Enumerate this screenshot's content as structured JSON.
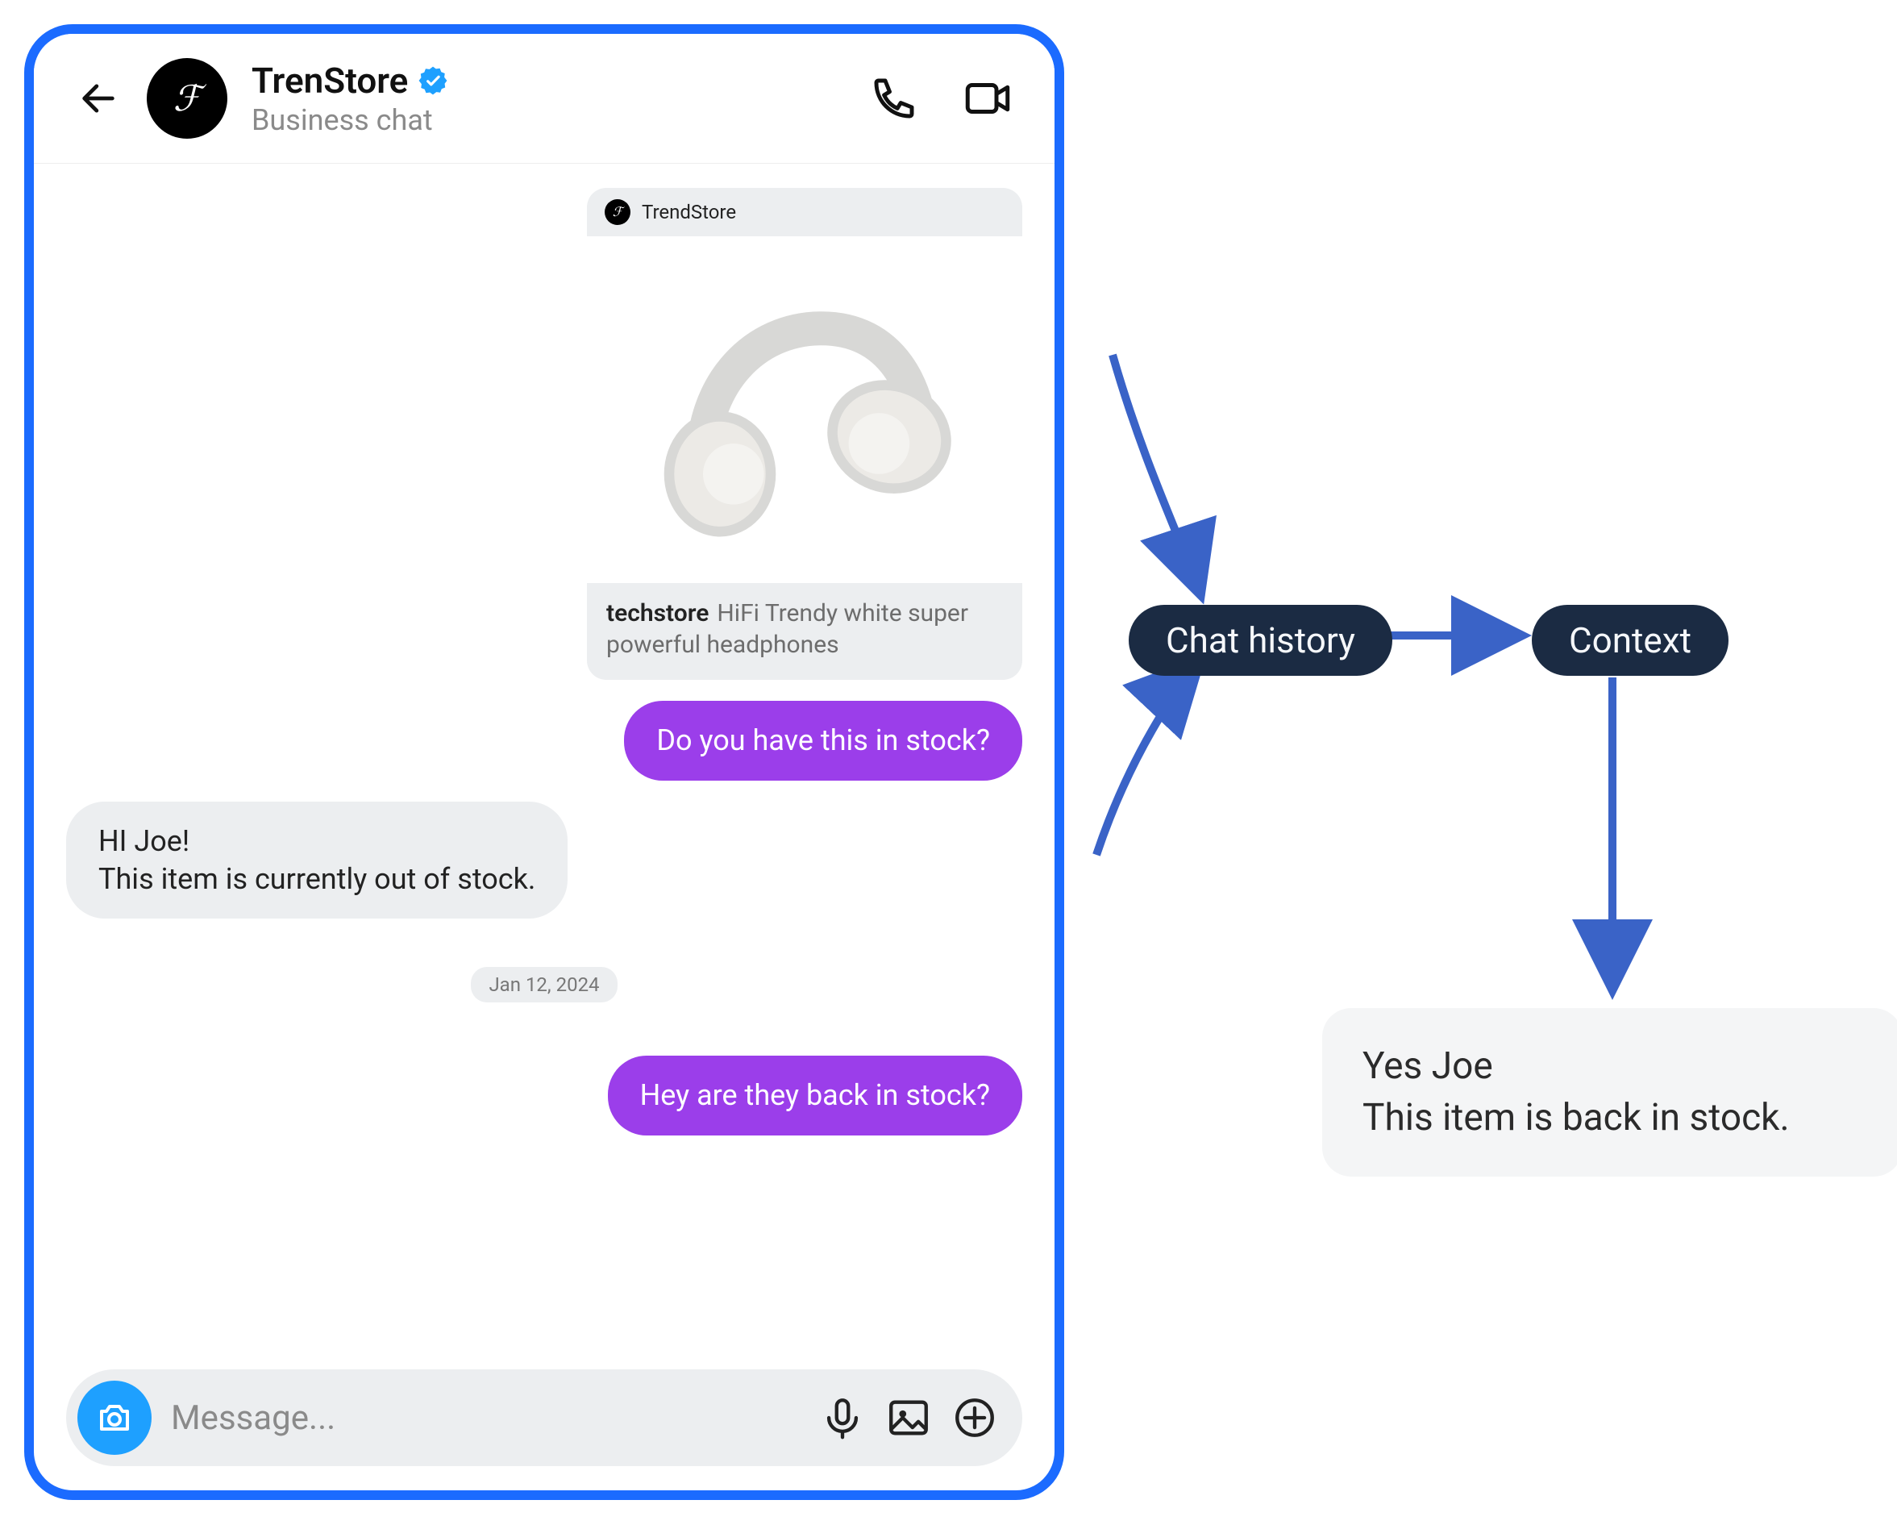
{
  "header": {
    "title": "TrenStore",
    "subtitle": "Business chat"
  },
  "shared_post": {
    "author": "TrendStore",
    "account": "techstore",
    "caption": "HiFi Trendy white super powerful headphones"
  },
  "messages": {
    "m1_out": "Do you have this in stock?",
    "m2_in_line1": "HI Joe!",
    "m2_in_line2": "This item is currently out of stock.",
    "date_sep": "Jan 12, 2024",
    "m3_out": "Hey are they back in stock?"
  },
  "composer": {
    "placeholder": "Message..."
  },
  "diagram": {
    "node_history": "Chat history",
    "node_context": "Context",
    "answer_line1": "Yes Joe",
    "answer_line2": "This item is back in stock."
  }
}
